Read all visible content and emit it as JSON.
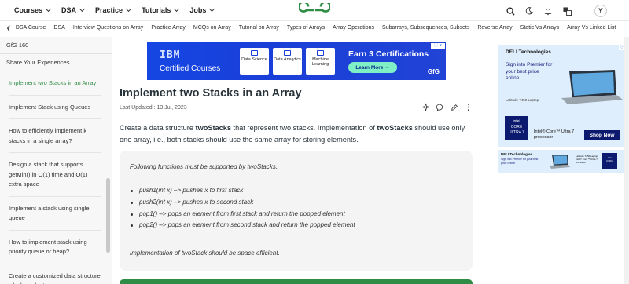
{
  "topnav": {
    "menu": [
      {
        "label": "Courses"
      },
      {
        "label": "DSA"
      },
      {
        "label": "Practice"
      },
      {
        "label": "Tutorials"
      },
      {
        "label": "Jobs"
      }
    ],
    "avatar_letter": "Y",
    "brand_color": "#2f8d46"
  },
  "subnav": {
    "items": [
      "DSA Course",
      "DSA",
      "Interview Questions on Array",
      "Practice Array",
      "MCQs on Array",
      "Tutorial on Array",
      "Types of Arrays",
      "Array Operations",
      "Subarrays, Subsequences, Subsets",
      "Reverse Array",
      "Static Vs Arrays",
      "Array Vs Linked List"
    ]
  },
  "sidebar": {
    "header": "GfG 160",
    "section": "Share Your Experiences",
    "items": [
      {
        "label": "Implement two Stacks in an Array",
        "active": true
      },
      {
        "label": "Implement Stack using Queues",
        "active": false
      },
      {
        "label": "How to efficiently implement k stacks in a single array?",
        "active": false
      },
      {
        "label": "Design a stack that supports getMin() in O(1) time and O(1) extra space",
        "active": false
      },
      {
        "label": "Implement a stack using single queue",
        "active": false
      },
      {
        "label": "How to implement stack using priority queue or heap?",
        "active": false
      },
      {
        "label": "Create a customized data structure which evaluates",
        "active": false
      }
    ]
  },
  "ad_banner": {
    "brand": "IBM",
    "headline": "Certified Courses",
    "cards": [
      "Data Science",
      "Data Analytics",
      "Machine Learning"
    ],
    "earn": "Earn 3 Certifications",
    "cta": "Learn More →",
    "footer_logo": "GfG"
  },
  "article": {
    "title": "Implement two Stacks in an Array",
    "updated": "Last Updated : 13 Jul, 2023",
    "intro_parts": [
      "Create a data structure ",
      "twoStacks",
      " that represent two stacks. Implementation of ",
      "twoStacks",
      " should use only one array, i.e., both stacks should use the same array for storing elements."
    ],
    "box_intro": "Following functions must be supported by twoStacks.",
    "functions": [
      "push1(int x) –> pushes x to first stack",
      "push2(int x) –> pushes x to second stack",
      "pop1() –> pops an element from first stack and return the popped element",
      "pop2() –> pops an element from second stack and return the popped element"
    ],
    "box_outro": "Implementation of twoStack should be space efficient."
  },
  "right_ad": {
    "brand": "DELLTechnologies",
    "pitch": "Sign into Premier for your best price online.",
    "model": "Latitude 7450 Laptop",
    "chip_line1": "intel",
    "chip_line2": "CORE",
    "chip_line3": "ULTRA 7",
    "processor": "Intel® Core™ Ultra 7 processor",
    "cta": "Shop Now"
  },
  "right_ad_small": {
    "brand": "DELLTechnologies",
    "pitch": "Sign into Premier for your best price online.",
    "model": "Latitude 7450 Laptop",
    "processor": "Intel® Core™ Ultra 7 processor",
    "chip_line1": "intel",
    "chip_line2": "CORE"
  }
}
